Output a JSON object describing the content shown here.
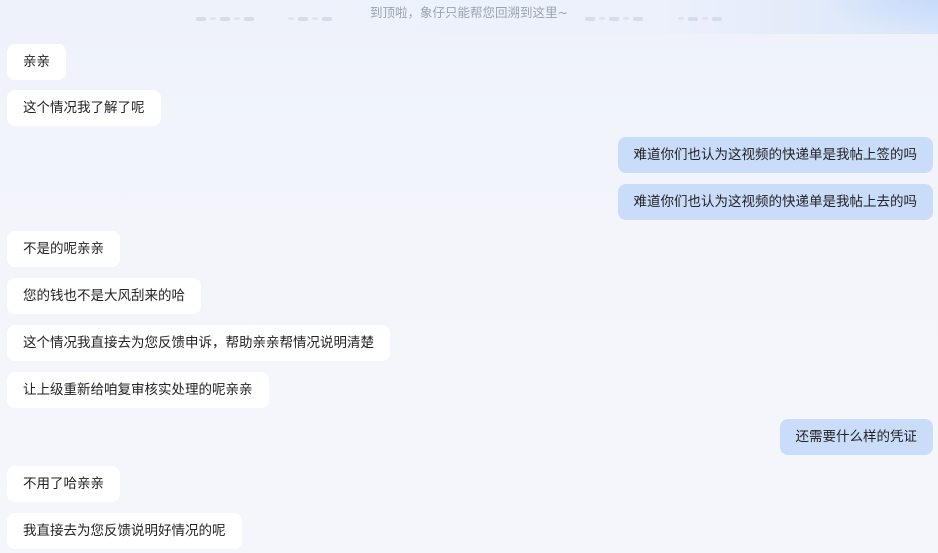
{
  "top_notice": "到顶啦，象仔只能帮您回溯到这里~",
  "messages": [
    {
      "side": "left",
      "text": "亲亲"
    },
    {
      "side": "left",
      "text": "这个情况我了解了呢"
    },
    {
      "side": "right",
      "text": "难道你们也认为这视频的快递单是我帖上签的吗"
    },
    {
      "side": "right",
      "text": "难道你们也认为这视频的快递单是我帖上去的吗"
    },
    {
      "side": "left",
      "text": "不是的呢亲亲"
    },
    {
      "side": "left",
      "text": "您的钱也不是大风刮来的哈"
    },
    {
      "side": "left",
      "text": "这个情况我直接去为您反馈申诉，帮助亲亲帮情况说明清楚"
    },
    {
      "side": "left",
      "text": "让上级重新给咱复审核实处理的呢亲亲"
    },
    {
      "side": "right",
      "text": "还需要什么样的凭证"
    },
    {
      "side": "left",
      "text": "不用了哈亲亲"
    },
    {
      "side": "left",
      "text": "我直接去为您反馈说明好情况的呢"
    }
  ],
  "colors": {
    "customer_bubble": "#c9dcf9",
    "agent_bubble": "#ffffff",
    "background": "#f3f5fb"
  }
}
